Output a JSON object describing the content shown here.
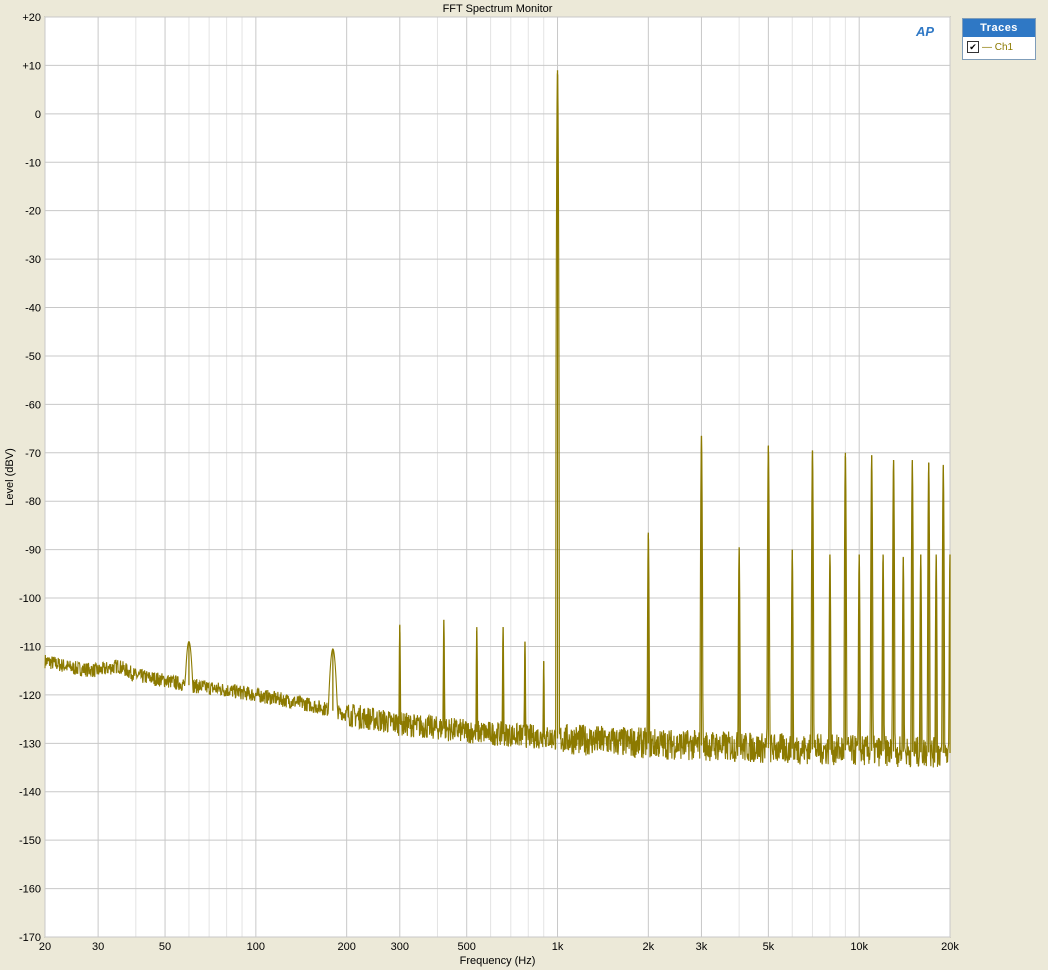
{
  "chart_data": {
    "type": "line",
    "title": "FFT Spectrum Monitor",
    "xlabel": "Frequency (Hz)",
    "ylabel": "Level (dBV)",
    "xscale": "log",
    "xlim": [
      20,
      20000
    ],
    "ylim": [
      -170,
      20
    ],
    "x_ticks": [
      20,
      30,
      50,
      100,
      200,
      300,
      500,
      1000,
      2000,
      3000,
      5000,
      10000,
      20000
    ],
    "x_tick_labels": [
      "20",
      "30",
      "50",
      "100",
      "200",
      "300",
      "500",
      "1k",
      "2k",
      "3k",
      "5k",
      "10k",
      "20k"
    ],
    "y_ticks": [
      20,
      10,
      0,
      -10,
      -20,
      -30,
      -40,
      -50,
      -60,
      -70,
      -80,
      -90,
      -100,
      -110,
      -120,
      -130,
      -140,
      -150,
      -160,
      -170
    ],
    "y_tick_labels": [
      "+20",
      "+10",
      "0",
      "-10",
      "-20",
      "-30",
      "-40",
      "-50",
      "-60",
      "-70",
      "-80",
      "-90",
      "-100",
      "-110",
      "-120",
      "-130",
      "-140",
      "-150",
      "-160",
      "-170"
    ],
    "grid": true,
    "legend_position": "top-right",
    "series": [
      {
        "name": "Ch1",
        "color": "#8c7a00",
        "noise_floor": [
          [
            20,
            -113
          ],
          [
            25,
            -114.5
          ],
          [
            30,
            -115
          ],
          [
            35,
            -114
          ],
          [
            40,
            -116
          ],
          [
            50,
            -117
          ],
          [
            60,
            -118
          ],
          [
            80,
            -119
          ],
          [
            100,
            -120
          ],
          [
            150,
            -122
          ],
          [
            200,
            -124
          ],
          [
            300,
            -126
          ],
          [
            500,
            -127.5
          ],
          [
            1000,
            -129
          ],
          [
            2000,
            -130
          ],
          [
            5000,
            -131
          ],
          [
            10000,
            -131.5
          ],
          [
            20000,
            -132
          ]
        ],
        "peaks": [
          [
            60,
            -109
          ],
          [
            180,
            -110.5
          ],
          [
            300,
            -105.5
          ],
          [
            420,
            -104.5
          ],
          [
            540,
            -106
          ],
          [
            660,
            -106
          ],
          [
            780,
            -109
          ],
          [
            900,
            -113
          ],
          [
            1000,
            9
          ],
          [
            2000,
            -86.5
          ],
          [
            3000,
            -66.5
          ],
          [
            4000,
            -89.5
          ],
          [
            5000,
            -68.5
          ],
          [
            6000,
            -90
          ],
          [
            7000,
            -69.5
          ],
          [
            8000,
            -91
          ],
          [
            9000,
            -70
          ],
          [
            10000,
            -91
          ],
          [
            11000,
            -70.5
          ],
          [
            12000,
            -91
          ],
          [
            13000,
            -71.5
          ],
          [
            14000,
            -91.5
          ],
          [
            15000,
            -71.5
          ],
          [
            16000,
            -91
          ],
          [
            17000,
            -72
          ],
          [
            18000,
            -91
          ],
          [
            19000,
            -72.5
          ],
          [
            20000,
            -91
          ]
        ]
      }
    ]
  },
  "legend": {
    "header": "Traces",
    "items": [
      {
        "label": "— Ch1",
        "checked": true,
        "check_glyph": "✔"
      }
    ]
  },
  "logo": {
    "text": "AP"
  }
}
